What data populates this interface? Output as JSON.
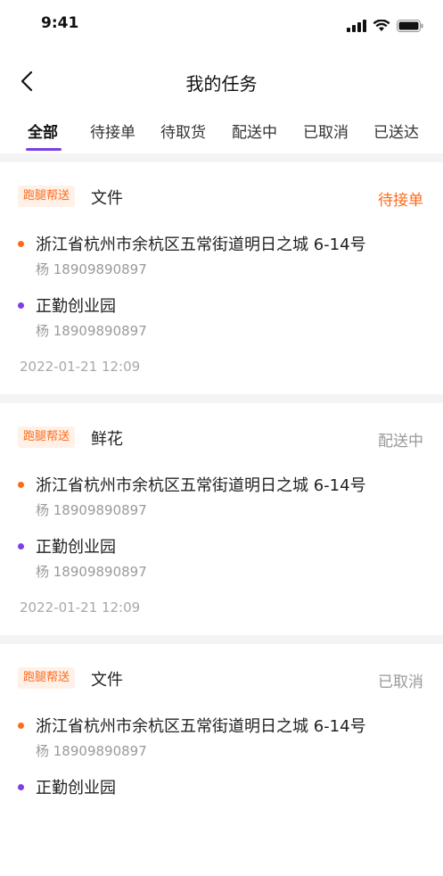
{
  "status_bar": {
    "time": "9:41"
  },
  "nav": {
    "title": "我的任务"
  },
  "tabs": [
    {
      "label": "全部",
      "active": true
    },
    {
      "label": "待接单",
      "active": false
    },
    {
      "label": "待取货",
      "active": false
    },
    {
      "label": "配送中",
      "active": false
    },
    {
      "label": "已取消",
      "active": false
    },
    {
      "label": "已送达",
      "active": false
    }
  ],
  "colors": {
    "accent": "#7b3fe4",
    "orange": "#ff6a1a",
    "status_pending": "#ff6a1a",
    "status_other": "#999999"
  },
  "orders": [
    {
      "badge": "跑腿帮送",
      "cargo": "文件",
      "status": "待接单",
      "status_color": "#ff6a1a",
      "from_address": "浙江省杭州市余杭区五常街道明日之城 6-14号",
      "from_contact": "杨 18909890897",
      "to_address": "正勤创业园",
      "to_contact": "杨 18909890897",
      "time": "2022-01-21 12:09"
    },
    {
      "badge": "跑腿帮送",
      "cargo": "鲜花",
      "status": "配送中",
      "status_color": "#999999",
      "from_address": "浙江省杭州市余杭区五常街道明日之城 6-14号",
      "from_contact": "杨 18909890897",
      "to_address": "正勤创业园",
      "to_contact": "杨 18909890897",
      "time": "2022-01-21 12:09"
    },
    {
      "badge": "跑腿帮送",
      "cargo": "文件",
      "status": "已取消",
      "status_color": "#999999",
      "from_address": "浙江省杭州市余杭区五常街道明日之城 6-14号",
      "from_contact": "杨 18909890897",
      "to_address": "正勤创业园",
      "to_contact": "",
      "time": ""
    }
  ]
}
